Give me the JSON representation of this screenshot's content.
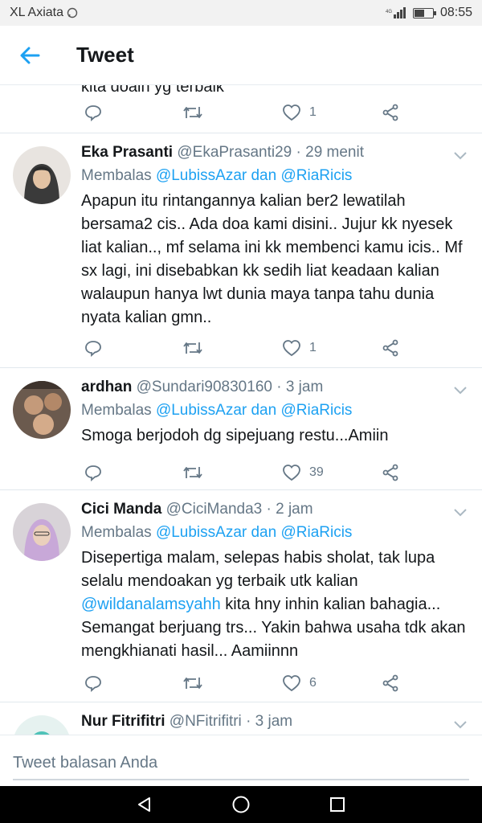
{
  "status": {
    "carrier": "XL Axiata",
    "time": "08:55",
    "battery_level": 0.5
  },
  "appbar": {
    "title": "Tweet"
  },
  "prev_tweet": {
    "partial_text": "kita doain yg terbaik",
    "likes": "1"
  },
  "tweets": [
    {
      "name": "Eka Prasanti",
      "handle": "@EkaPrasanti29",
      "time": "· 29 menit",
      "reply_prefix": "Membalas",
      "reply_targets": "@LubissAzar dan @RiaRicis",
      "text": "Apapun itu rintangannya kalian ber2 lewatilah bersama2 cis.. Ada doa kami disini.. Jujur kk nyesek liat kalian.., mf selama ini kk membenci kamu icis.. Mf sx lagi, ini disebabkan kk sedih liat keadaan kalian walaupun hanya lwt dunia maya tanpa tahu dunia nyata kalian gmn..",
      "likes": "1"
    },
    {
      "name": "ardhan",
      "handle": "@Sundari90830160",
      "time": "· 3 jam",
      "reply_prefix": "Membalas",
      "reply_targets": "@LubissAzar dan @RiaRicis",
      "text": "Smoga berjodoh dg sipejuang restu...Amiin",
      "likes": "39"
    },
    {
      "name": "Cici Manda",
      "handle": "@CiciManda3",
      "time": "· 2 jam",
      "reply_prefix": "Membalas",
      "reply_targets": "@LubissAzar dan @RiaRicis",
      "text_before": "Disepertiga malam, selepas habis sholat, tak lupa selalu mendoakan yg terbaik utk kalian",
      "mention": "@wildanalamsyahh",
      "text_after": "kita hny inhin kalian bahagia... Semangat berjuang trs... Yakin bahwa usaha tdk akan mengkhianati hasil... Aamiinnn",
      "likes": "6"
    },
    {
      "name": "Nur Fitrifitri",
      "handle": "@NFitrifitri",
      "time": "· 3 jam"
    }
  ],
  "composer": {
    "placeholder": "Tweet balasan Anda"
  },
  "colors": {
    "accent": "#1da1f2",
    "secondary_text": "#657786",
    "primary_text": "#14171a"
  }
}
